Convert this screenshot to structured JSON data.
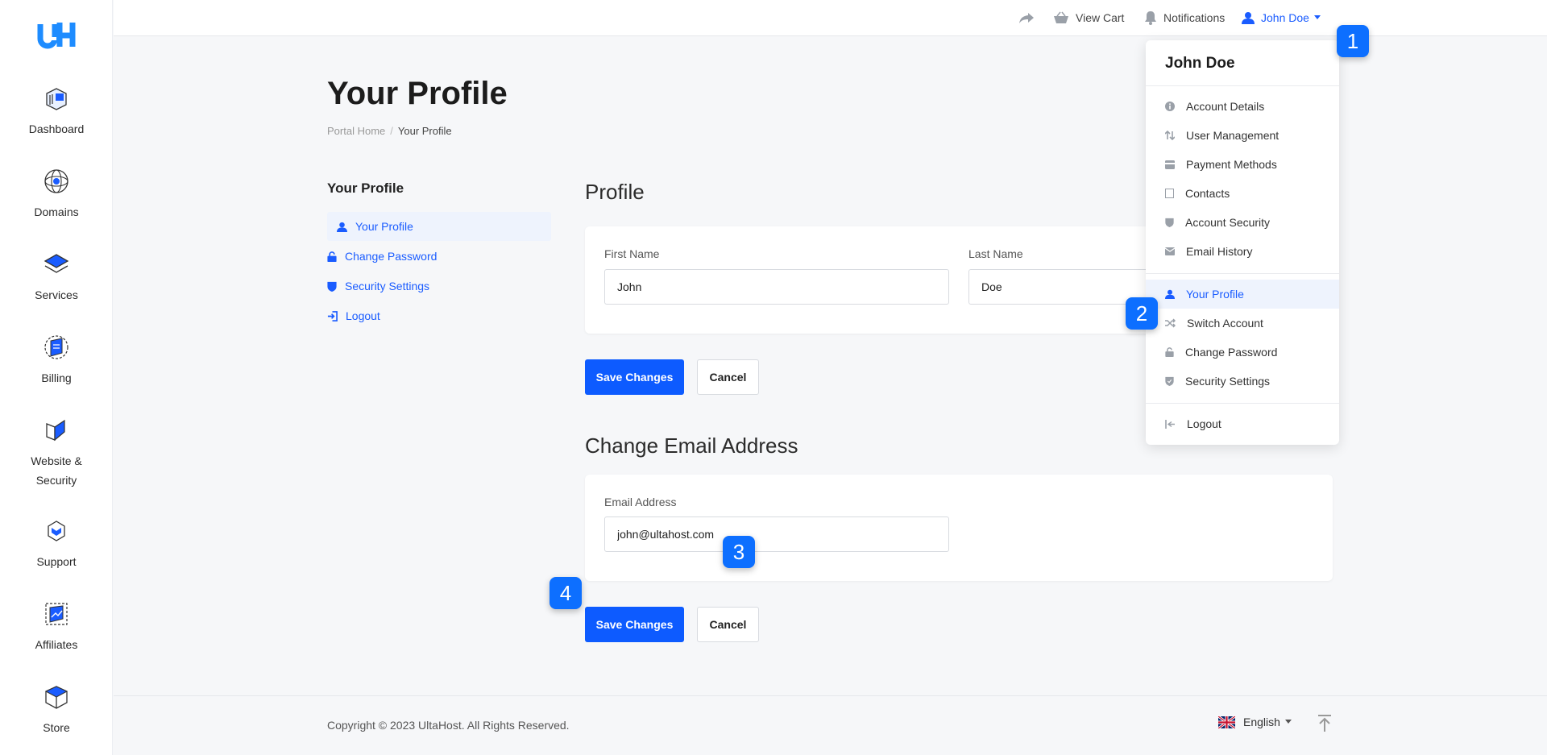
{
  "colors": {
    "accent": "#0d5bff",
    "link": "#1a5cff",
    "badge": "#0d6fff"
  },
  "leftnav": {
    "items": [
      {
        "label": "Dashboard",
        "icon": "dashboard-icon"
      },
      {
        "label": "Domains",
        "icon": "globe-icon"
      },
      {
        "label": "Services",
        "icon": "layers-icon"
      },
      {
        "label": "Billing",
        "icon": "billing-icon"
      },
      {
        "label": "Website &",
        "label2": "Security",
        "icon": "shield-icon"
      },
      {
        "label": "Support",
        "icon": "support-icon"
      },
      {
        "label": "Affiliates",
        "icon": "affiliates-icon"
      },
      {
        "label": "Store",
        "icon": "store-icon"
      }
    ]
  },
  "topbar": {
    "view_cart": "View Cart",
    "notifications": "Notifications",
    "user_name": "John Doe"
  },
  "page": {
    "title": "Your Profile",
    "breadcrumb": {
      "home": "Portal Home",
      "sep": "/",
      "current": "Your Profile"
    }
  },
  "side": {
    "title": "Your Profile",
    "items": [
      "Your Profile",
      "Change Password",
      "Security Settings",
      "Logout"
    ]
  },
  "profile": {
    "title": "Profile",
    "first_name_label": "First Name",
    "first_name": "John",
    "last_name_label": "Last Name",
    "last_name": "Doe",
    "save": "Save Changes",
    "cancel": "Cancel"
  },
  "email": {
    "title": "Change Email Address",
    "label": "Email Address",
    "value": "john@ultahost.com",
    "save": "Save Changes",
    "cancel": "Cancel"
  },
  "footer": {
    "copyright": "Copyright © 2023 UltaHost. All Rights Reserved.",
    "language": "English"
  },
  "dropdown": {
    "title": "John Doe",
    "group1": [
      "Account Details",
      "User Management",
      "Payment Methods",
      "Contacts",
      "Account Security",
      "Email History"
    ],
    "group2": [
      "Your Profile",
      "Switch Account",
      "Change Password",
      "Security Settings"
    ],
    "logout": "Logout"
  },
  "badges": [
    "1",
    "2",
    "3",
    "4"
  ]
}
